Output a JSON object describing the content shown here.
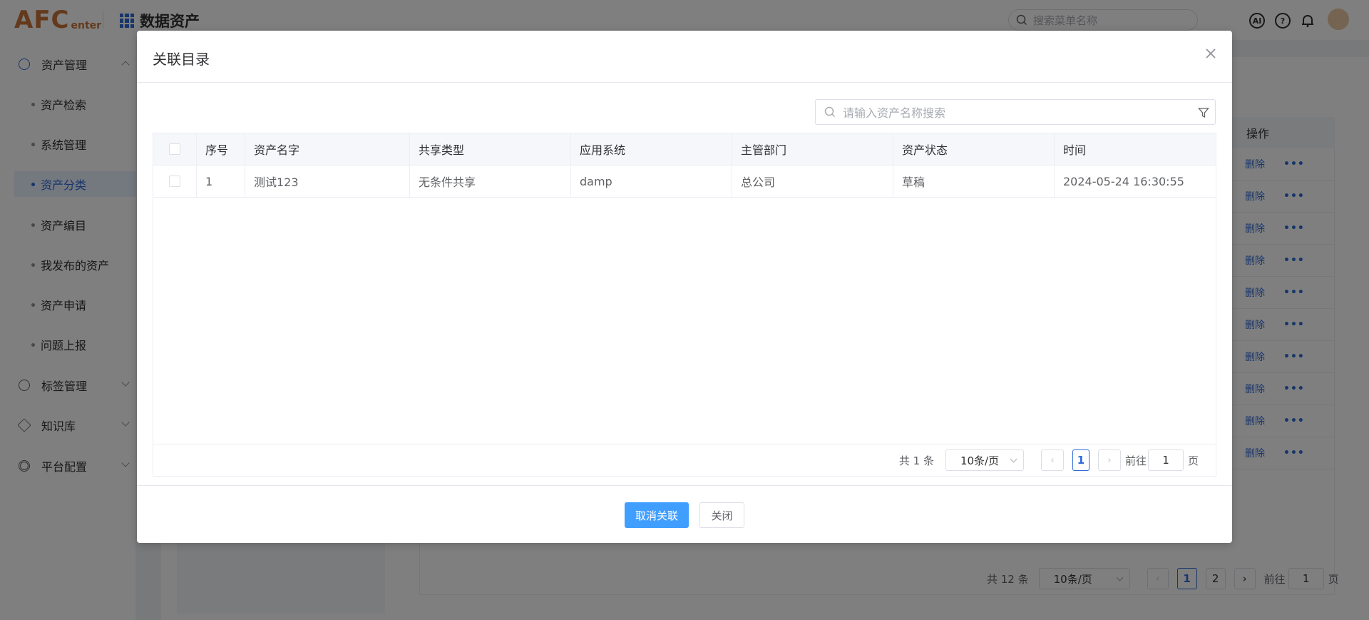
{
  "app": {
    "logo_main": "AFC",
    "logo_sub": "enter",
    "title": "数据资产",
    "search_placeholder": "搜索菜单名称"
  },
  "sidebar": {
    "groups": [
      {
        "label": "资产管理",
        "icon": "clock-icon",
        "expanded": true
      },
      {
        "label": "标签管理",
        "icon": "plus-circle-icon"
      },
      {
        "label": "知识库",
        "icon": "tag-icon"
      },
      {
        "label": "平台配置",
        "icon": "settings-icon"
      }
    ],
    "items": [
      {
        "label": "资产检索"
      },
      {
        "label": "系统管理"
      },
      {
        "label": "资产分类",
        "active": true
      },
      {
        "label": "资产编目"
      },
      {
        "label": "我发布的资产"
      },
      {
        "label": "资产申请"
      },
      {
        "label": "问题上报"
      }
    ]
  },
  "background_table": {
    "op_header": "操作",
    "delete_label": "删除",
    "more_label": "•••",
    "pager": {
      "total": "共 12 条",
      "page_size": "10条/页",
      "pages": [
        "1",
        "2"
      ],
      "goto_label": "前往",
      "goto_value": "1",
      "page_unit": "页"
    }
  },
  "dialog": {
    "title": "关联目录",
    "search_placeholder": "请输入资产名称搜索",
    "columns": [
      "序号",
      "资产名字",
      "共享类型",
      "应用系统",
      "主管部门",
      "资产状态",
      "时间"
    ],
    "rows": [
      {
        "index": "1",
        "name": "测试123",
        "share_type": "无条件共享",
        "system": "damp",
        "department": "总公司",
        "status": "草稿",
        "time": "2024-05-24 16:30:55"
      }
    ],
    "pager": {
      "total": "共 1 条",
      "page_size": "10条/页",
      "current": "1",
      "goto_label": "前往",
      "goto_value": "1",
      "page_unit": "页"
    },
    "buttons": {
      "primary": "取消关联",
      "close": "关闭"
    }
  },
  "colors": {
    "primary": "#409eff",
    "link": "#2f6bd8",
    "logo": "#c8743a"
  }
}
